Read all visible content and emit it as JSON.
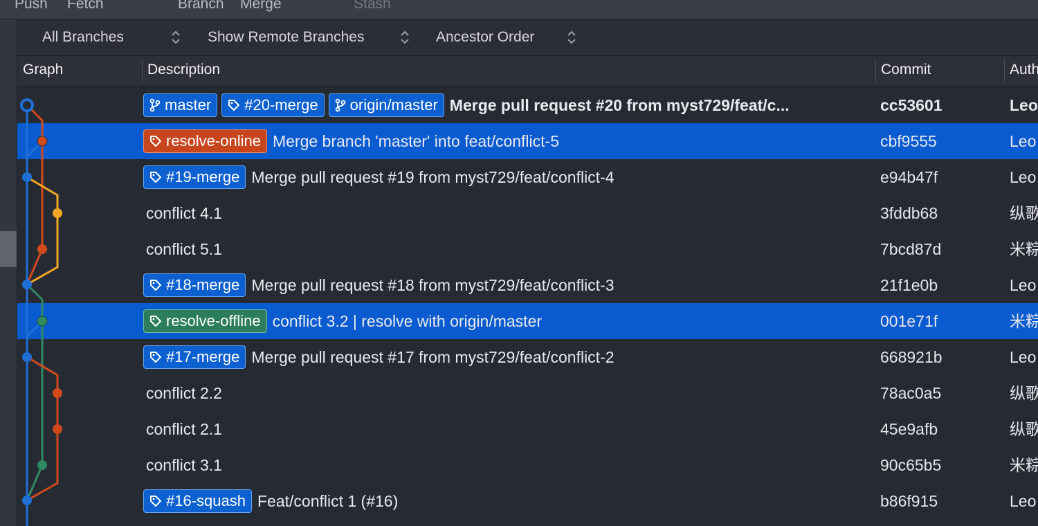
{
  "toolbar": {
    "buttons": [
      "Push",
      "Fetch",
      "Branch",
      "Merge",
      "Stash"
    ]
  },
  "filters": {
    "branches": "All Branches",
    "remote": "Show Remote Branches",
    "order": "Ancestor Order"
  },
  "columns": {
    "graph": "Graph",
    "description": "Description",
    "commit": "Commit",
    "author": "Auth"
  },
  "colors": {
    "selected_row": "#0a5bd0",
    "tag_blue": "#0c60cf",
    "tag_red": "#c8461d",
    "tag_green": "#2c7d5b",
    "lane_blue": "#1e6fd6",
    "lane_red": "#d24a1c",
    "lane_orange": "#f5a623",
    "lane_green": "#2f8a62"
  },
  "commits": [
    {
      "tags": [
        {
          "label": "master",
          "icon": "branch-icon",
          "color": "blue"
        },
        {
          "label": "#20-merge",
          "icon": "tag-icon",
          "color": "blue"
        },
        {
          "label": "origin/master",
          "icon": "branch-icon",
          "color": "blue"
        }
      ],
      "message": "Merge pull request #20 from myst729/feat/c...",
      "commit": "cc53601",
      "author": "Leo",
      "selected": false,
      "bold": true
    },
    {
      "tags": [
        {
          "label": "resolve-online",
          "icon": "tag-icon",
          "color": "red"
        }
      ],
      "message": "Merge branch 'master' into feat/conflict-5",
      "commit": "cbf9555",
      "author": "Leo",
      "selected": true,
      "bold": false
    },
    {
      "tags": [
        {
          "label": "#19-merge",
          "icon": "tag-icon",
          "color": "blue"
        }
      ],
      "message": "Merge pull request #19 from myst729/feat/conflict-4",
      "commit": "e94b47f",
      "author": "Leo",
      "selected": false,
      "bold": false
    },
    {
      "tags": [],
      "message": "conflict 4.1",
      "commit": "3fddb68",
      "author": "纵歌",
      "selected": false,
      "bold": false
    },
    {
      "tags": [],
      "message": "conflict 5.1",
      "commit": "7bcd87d",
      "author": "米粽",
      "selected": false,
      "bold": false
    },
    {
      "tags": [
        {
          "label": "#18-merge",
          "icon": "tag-icon",
          "color": "blue"
        }
      ],
      "message": "Merge pull request #18 from myst729/feat/conflict-3",
      "commit": "21f1e0b",
      "author": "Leo",
      "selected": false,
      "bold": false
    },
    {
      "tags": [
        {
          "label": "resolve-offline",
          "icon": "tag-icon",
          "color": "green"
        }
      ],
      "message": "conflict 3.2 | resolve with origin/master",
      "commit": "001e71f",
      "author": "米粽",
      "selected": true,
      "bold": false
    },
    {
      "tags": [
        {
          "label": "#17-merge",
          "icon": "tag-icon",
          "color": "blue"
        }
      ],
      "message": "Merge pull request #17 from myst729/feat/conflict-2",
      "commit": "668921b",
      "author": "Leo",
      "selected": false,
      "bold": false
    },
    {
      "tags": [],
      "message": "conflict 2.2",
      "commit": "78ac0a5",
      "author": "纵歌",
      "selected": false,
      "bold": false
    },
    {
      "tags": [],
      "message": "conflict 2.1",
      "commit": "45e9afb",
      "author": "纵歌",
      "selected": false,
      "bold": false
    },
    {
      "tags": [],
      "message": "conflict 3.1",
      "commit": "90c65b5",
      "author": "米粽",
      "selected": false,
      "bold": false
    },
    {
      "tags": [
        {
          "label": "#16-squash",
          "icon": "tag-icon",
          "color": "blue"
        }
      ],
      "message": "Feat/conflict 1 (#16)",
      "commit": "b86f915",
      "author": "Leo",
      "selected": false,
      "bold": false
    }
  ]
}
